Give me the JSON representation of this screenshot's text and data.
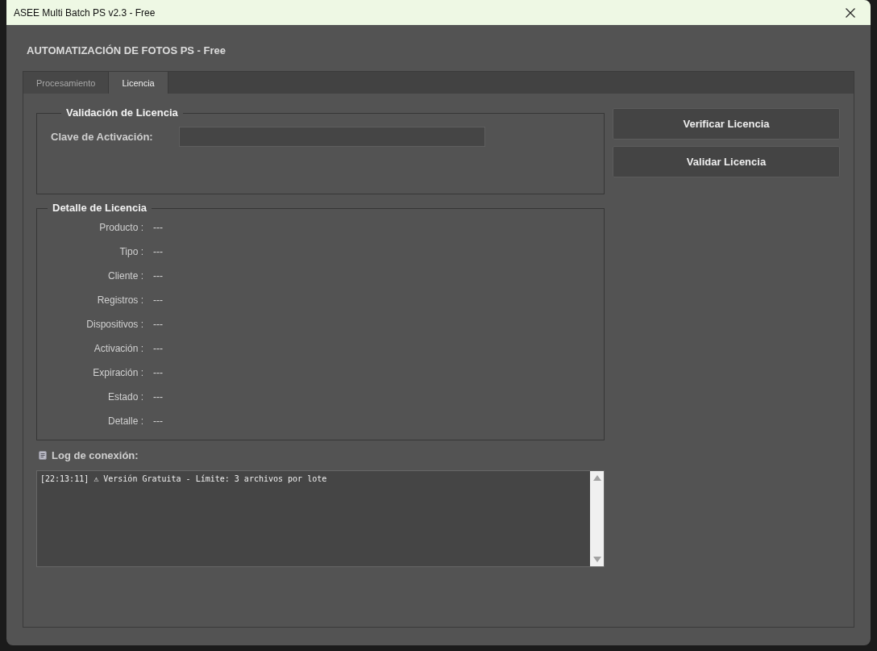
{
  "window": {
    "title": "ASEE Multi Batch PS v2.3 - Free"
  },
  "header": {
    "title": "AUTOMATIZACIÓN DE FOTOS PS - Free"
  },
  "tabs": [
    {
      "label": "Procesamiento",
      "selected": false
    },
    {
      "label": "Licencia",
      "selected": true
    }
  ],
  "validation_group": {
    "title": "Validación de Licencia",
    "field": {
      "label": "Clave de Activación:"
    }
  },
  "buttons": [
    {
      "label": "Verificar Licencia"
    },
    {
      "label": "Validar Licencia"
    }
  ],
  "details_group": {
    "title": "Detalle de Licencia",
    "rows": [
      {
        "label": "Producto :",
        "value": "---"
      },
      {
        "label": "Tipo :",
        "value": "---"
      },
      {
        "label": "Cliente :",
        "value": "---"
      },
      {
        "label": "Registros :",
        "value": "---"
      },
      {
        "label": "Dispositivos :",
        "value": "---"
      },
      {
        "label": "Activación :",
        "value": "---"
      },
      {
        "label": "Expiración :",
        "value": "---"
      },
      {
        "label": "Estado :",
        "value": "---"
      },
      {
        "label": "Detalle :",
        "value": "---"
      }
    ]
  },
  "log": {
    "label": "Log de conexión:",
    "lines": [
      "[22:13:11] ⚠ Versión Gratuita - Límite: 3 archivos por lote"
    ]
  }
}
